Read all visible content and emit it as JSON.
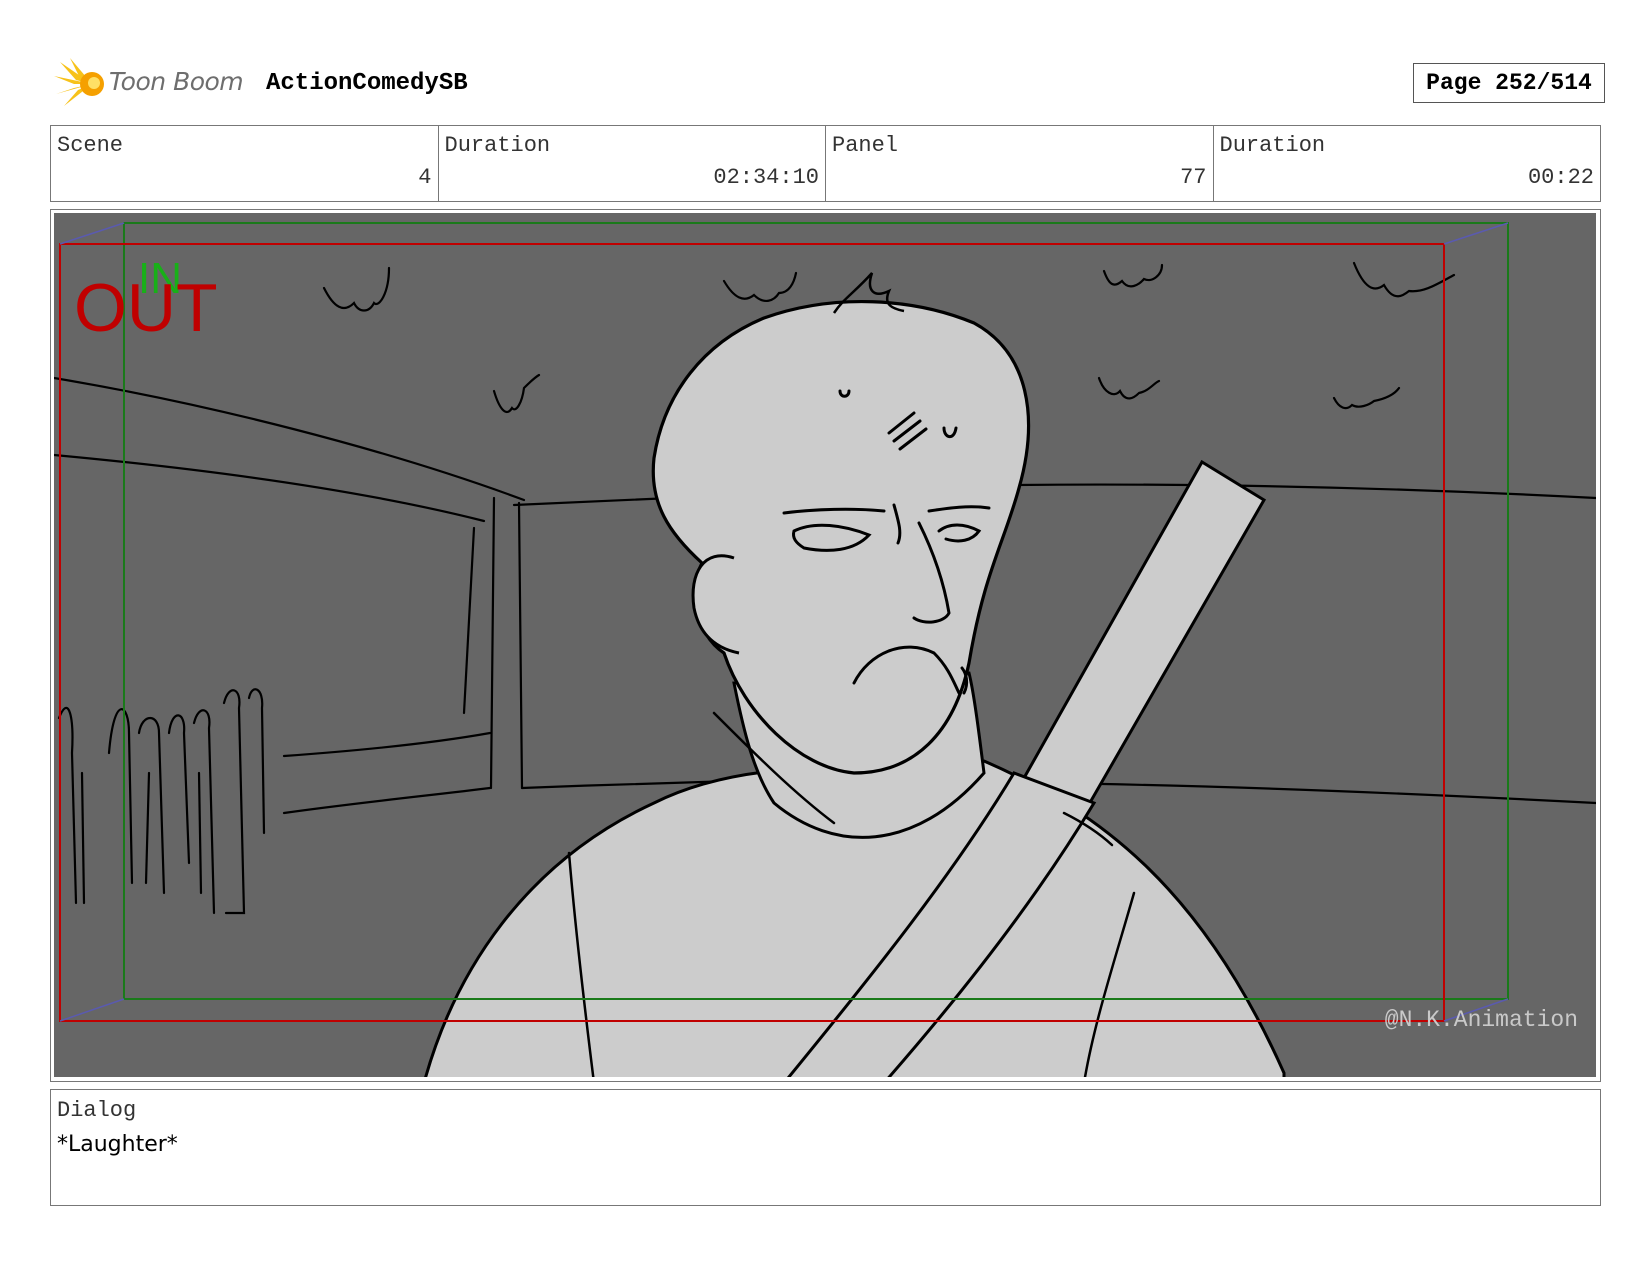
{
  "header": {
    "logo_text": "Toon Boom",
    "project_name": "ActionComedySB",
    "page_label": "Page 252/514"
  },
  "info": {
    "scene_label": "Scene",
    "scene_value": "4",
    "scene_duration_label": "Duration",
    "scene_duration_value": "02:34:10",
    "panel_label": "Panel",
    "panel_value": "77",
    "panel_duration_label": "Duration",
    "panel_duration_value": "00:22"
  },
  "panel": {
    "in_label": "IN",
    "out_label": "OUT",
    "watermark": "@N.K.Animation",
    "background_color": "#666666",
    "figure_color": "#cccccc",
    "in_frame_color": "#1a7a1a",
    "out_frame_color": "#c00000"
  },
  "dialog": {
    "label": "Dialog",
    "text": "*Laughter*"
  }
}
